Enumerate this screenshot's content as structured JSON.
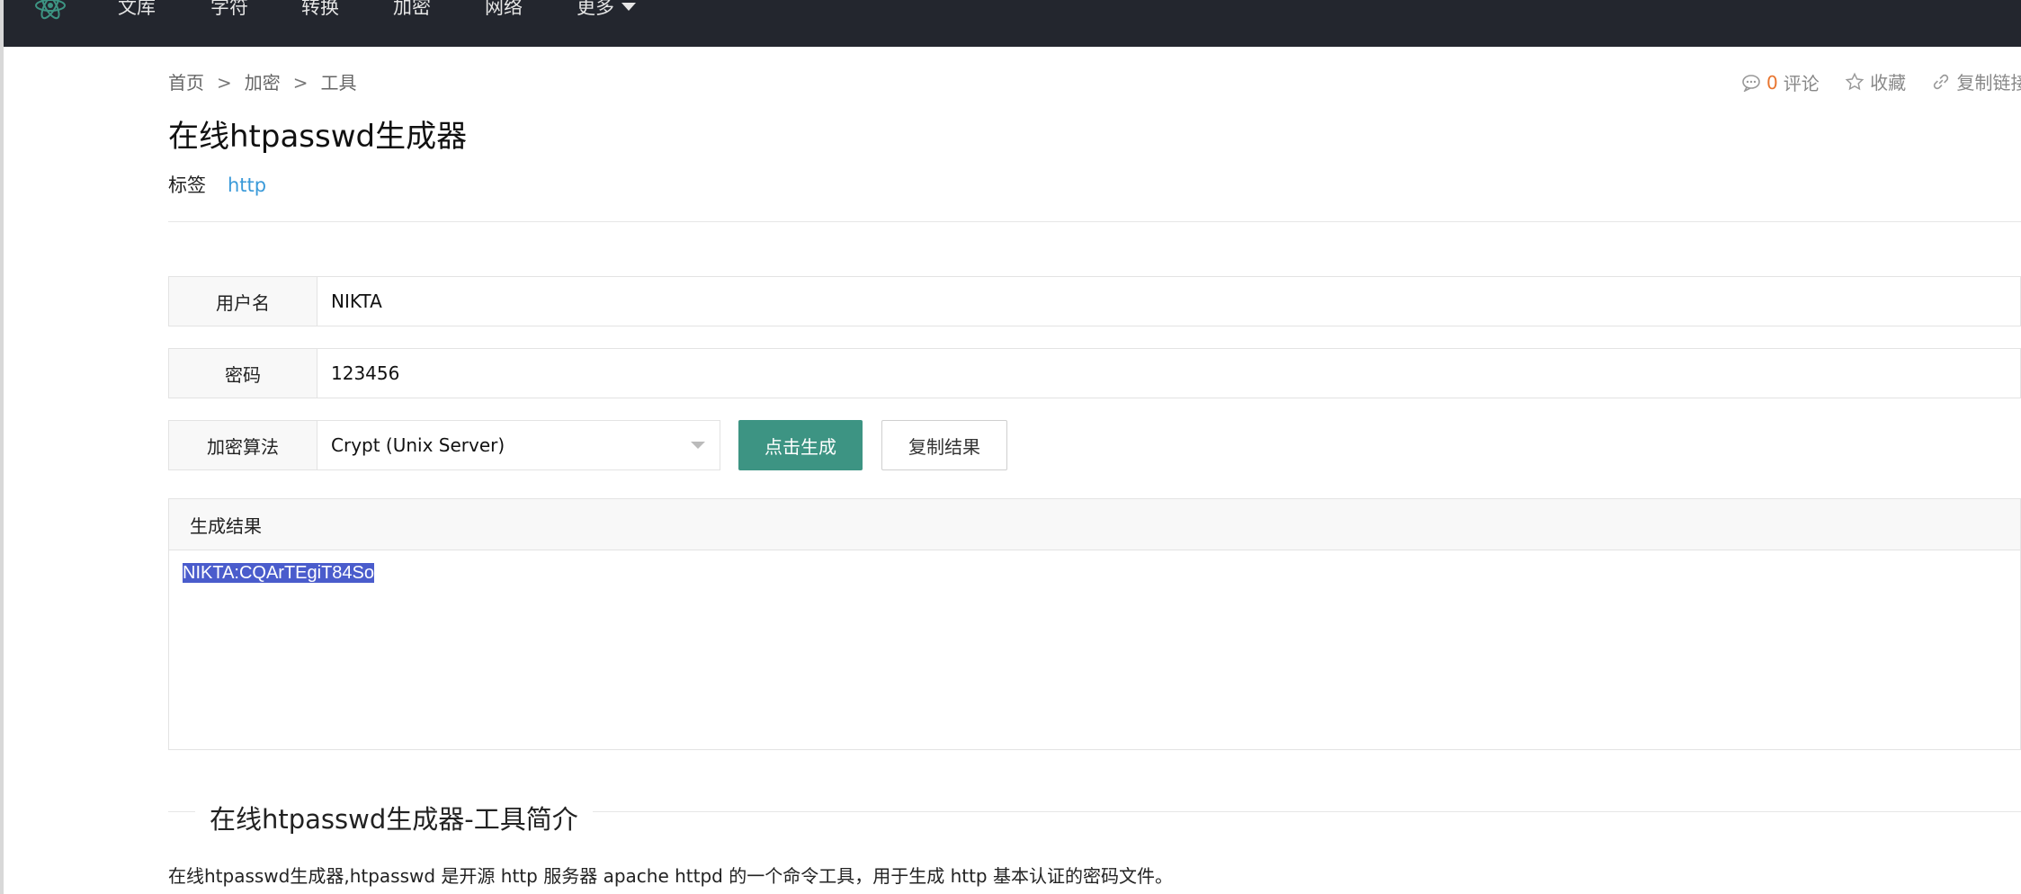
{
  "nav": {
    "items": [
      "文库",
      "字符",
      "转换",
      "加密",
      "网络"
    ],
    "more_label": "更多"
  },
  "breadcrumb": [
    "首页",
    "加密",
    "工具"
  ],
  "meta": {
    "comment_count": "0",
    "comment_label": "评论",
    "favorite_label": "收藏",
    "copy_link_label": "复制链接"
  },
  "page": {
    "title": "在线htpasswd生成器",
    "tags_label": "标签",
    "tag": "http"
  },
  "form": {
    "username_label": "用户名",
    "username_value": "NIKTA",
    "password_label": "密码",
    "password_value": "123456",
    "algorithm_label": "加密算法",
    "algorithm_value": "Crypt (Unix Server)",
    "generate_label": "点击生成",
    "copy_label": "复制结果"
  },
  "result": {
    "header": "生成结果",
    "value": "NIKTA:CQArTEgiT84So"
  },
  "intro": {
    "heading": "在线htpasswd生成器-工具简介",
    "text": "在线htpasswd生成器,htpasswd 是开源 http 服务器 apache httpd 的一个命令工具，用于生成 http 基本认证的密码文件。"
  },
  "colors": {
    "topbar": "#23262e",
    "primary_button": "#3d9483",
    "link": "#3a9ad9",
    "count": "#e8752f",
    "selection": "#4a5ccc"
  }
}
